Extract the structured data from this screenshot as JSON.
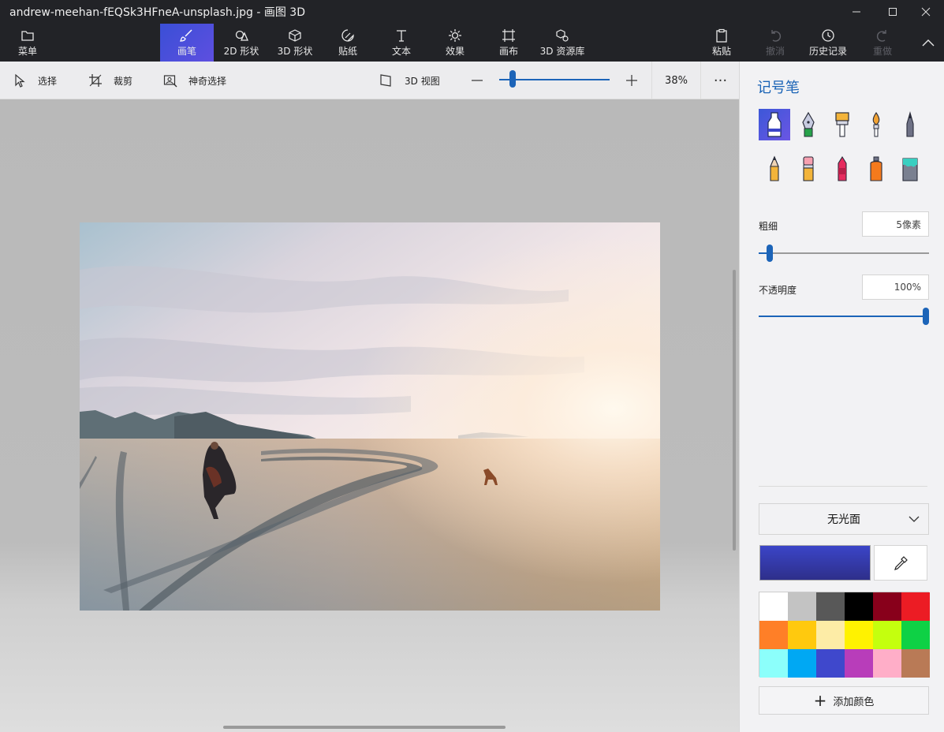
{
  "window": {
    "title": "andrew-meehan-fEQSk3HFneA-unsplash.jpg - 画图 3D"
  },
  "toolbar": {
    "menu_label": "菜单",
    "tabs": [
      {
        "label": "画笔",
        "icon": "brush-icon",
        "active": true
      },
      {
        "label": "2D 形状",
        "icon": "2d-shapes-icon"
      },
      {
        "label": "3D 形状",
        "icon": "3d-shapes-icon"
      },
      {
        "label": "贴纸",
        "icon": "sticker-icon"
      },
      {
        "label": "文本",
        "icon": "text-icon"
      },
      {
        "label": "效果",
        "icon": "effects-icon"
      },
      {
        "label": "画布",
        "icon": "canvas-icon"
      },
      {
        "label": "3D 资源库",
        "icon": "3d-library-icon"
      }
    ],
    "paste_label": "粘贴",
    "undo_label": "撤消",
    "history_label": "历史记录",
    "redo_label": "重做"
  },
  "subtoolbar": {
    "select_label": "选择",
    "crop_label": "裁剪",
    "magic_select_label": "神奇选择",
    "view3d_label": "3D 视图",
    "zoom_percent": "38%",
    "zoom_level": 0.1,
    "more_label": "···"
  },
  "panel": {
    "title": "记号笔",
    "brushes": [
      {
        "name": "marker",
        "selected": true
      },
      {
        "name": "calligraphy-pen"
      },
      {
        "name": "oil-brush"
      },
      {
        "name": "watercolor"
      },
      {
        "name": "pixel-pen"
      },
      {
        "name": "pencil"
      },
      {
        "name": "eraser"
      },
      {
        "name": "crayon"
      },
      {
        "name": "spray-can"
      },
      {
        "name": "fill"
      }
    ],
    "thickness_label": "粗细",
    "thickness_value": "5像素",
    "thickness_level": 0.05,
    "opacity_label": "不透明度",
    "opacity_value": "100%",
    "opacity_level": 1.0,
    "finish_label": "无光面",
    "current_color": "#3b45c8",
    "add_color_label": "添加颜色",
    "palette": [
      "#ffffff",
      "#c3c3c3",
      "#585858",
      "#000000",
      "#88001b",
      "#ec1c24",
      "#ff7f27",
      "#ffc90e",
      "#fdeca6",
      "#fff200",
      "#c4ff0e",
      "#0ed145",
      "#8cfffb",
      "#00a8f3",
      "#3f48cc",
      "#b83dba",
      "#ffaec8",
      "#b97a56"
    ]
  }
}
